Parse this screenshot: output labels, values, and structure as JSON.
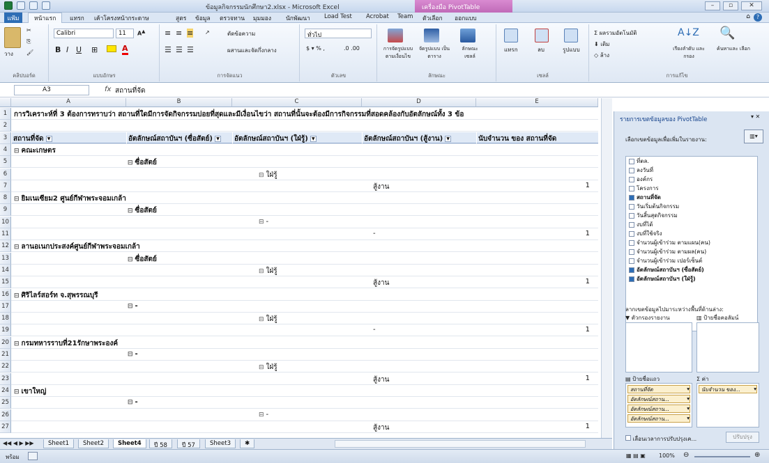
{
  "window": {
    "title": "ข้อมูลกิจกรรมนักศึกษา2.xlsx - Microsoft Excel",
    "context_tab": "เครื่องมือ PivotTable",
    "min": "–",
    "max": "▫",
    "close": "✕"
  },
  "tabs": [
    "หน้าแรก",
    "แทรก",
    "เค้าโครงหน้ากระดาษ",
    "สูตร",
    "ข้อมูล",
    "ตรวจทาน",
    "มุมมอง",
    "นักพัฒนา",
    "Load Test",
    "Acrobat",
    "Team",
    "ตัวเลือก",
    "ออกแบบ"
  ],
  "file_tab": "แฟ้ม",
  "ribbon": {
    "paste": "วาง",
    "clipboard": "คลิปบอร์ด",
    "font_name": "Calibri",
    "font_size": "11",
    "font_group": "แบบอักษร",
    "wrap": "ตัดข้อความ",
    "merge": "ผสานและจัดกึ่งกลาง",
    "align_group": "การจัดแนว",
    "number_format": "ทั่วไป",
    "number_group": "ตัวเลข",
    "cond_format": "การจัดรูปแบบ ตามเงื่อนไข",
    "format_table": "จัดรูปแบบ เป็นตาราง",
    "cell_styles": "ลักษณะ เซลล์",
    "styles_group": "ลักษณะ",
    "insert": "แทรก",
    "delete": "ลบ",
    "format": "รูปแบบ",
    "cells_group": "เซลล์",
    "autosum": "ผลรวมอัตโนมัติ",
    "fill": "เติม",
    "clear": "ล้าง",
    "sort": "เรียงลำดับ และกรอง",
    "find": "ค้นหาและ เลือก",
    "edit_group": "การแก้ไข"
  },
  "formula": {
    "name_box": "A3",
    "fx": "fx",
    "content": "สถานที่จัด"
  },
  "columns": [
    "A",
    "B",
    "C",
    "D",
    "E"
  ],
  "rows": [
    {
      "n": "1",
      "a": "การวิเคราะห์ที่ 3 ต้องการทราบว่า  สถานที่ใดมีการจัดกิจกรรมบ่อยที่สุดและมีเงื่อนไขว่า  สถานที่นั้นจะต้องมีการกิจกรรมที่สอดคล้องกับอัตลักษณ์ทั้ง  3 ข้อ"
    },
    {
      "n": "2"
    },
    {
      "n": "3",
      "header": [
        "สถานที่จัด",
        "อัตลักษณ์สถาบันฯ (ซื่อสัตย์)",
        "อัตลักษณ์สถาบันฯ (ใฝ่รู้)",
        "อัตลักษณ์สถาบันฯ (สู้งาน)",
        "นับจำนวน ของ สถานที่จัด"
      ]
    },
    {
      "n": "4",
      "a": "คณะเกษตร",
      "level": "a"
    },
    {
      "n": "5",
      "b": "ซื่อสัตย์"
    },
    {
      "n": "6",
      "c": "ใฝ่รู้"
    },
    {
      "n": "7",
      "d": "สู้งาน",
      "e": "1"
    },
    {
      "n": "8",
      "a": "ยิมเนเซียม2 ศูนย์กีฬาพระจอมเกล้า",
      "level": "a"
    },
    {
      "n": "9",
      "b": "ซื่อสัตย์"
    },
    {
      "n": "10",
      "c": "-"
    },
    {
      "n": "11",
      "d": "-",
      "e": "1"
    },
    {
      "n": "12",
      "a": "ลานอเนกประสงค์ศูนย์กีฬาพระจอมเกล้า",
      "level": "a"
    },
    {
      "n": "13",
      "b": "ซื่อสัตย์"
    },
    {
      "n": "14",
      "c": "ใฝ่รู้"
    },
    {
      "n": "15",
      "d": "สู้งาน",
      "e": "1"
    },
    {
      "n": "16",
      "a": "ศิริไลร์สอร์ท จ.สุพรรณบุรี",
      "level": "a"
    },
    {
      "n": "17",
      "b": "-"
    },
    {
      "n": "18",
      "c": "ใฝ่รู้"
    },
    {
      "n": "19",
      "d": "-",
      "e": "1"
    },
    {
      "n": "20",
      "a": "กรมทหารราบที่21รักษาพระองค์",
      "level": "a"
    },
    {
      "n": "21",
      "b": "-"
    },
    {
      "n": "22",
      "c": "ใฝ่รู้"
    },
    {
      "n": "23",
      "d": "สู้งาน",
      "e": "1"
    },
    {
      "n": "24",
      "a": "เขาใหญ่",
      "level": "a"
    },
    {
      "n": "25",
      "b": "-"
    },
    {
      "n": "26",
      "c": "-"
    },
    {
      "n": "27",
      "d": "สู้งาน",
      "e": "1"
    }
  ],
  "sheets": [
    "Sheet1",
    "Sheet2",
    "Sheet4",
    "ปี 58",
    "ปี 57",
    "Sheet3"
  ],
  "active_sheet": "Sheet4",
  "status": {
    "mode": "พร้อม",
    "zoom": "100%"
  },
  "pivot": {
    "title": "รายการเขตข้อมูลของ PivotTable",
    "choose": "เลือกเขตข้อมูลเพื่อเพิ่มในรายงาน:",
    "fields": [
      {
        "l": "ที่ตล.",
        "c": false
      },
      {
        "l": "ลงวันที่",
        "c": false
      },
      {
        "l": "องค์กร",
        "c": false
      },
      {
        "l": "โครงการ",
        "c": false
      },
      {
        "l": "สถานที่จัด",
        "c": true
      },
      {
        "l": "วันเริ่มต้นกิจกรรม",
        "c": false
      },
      {
        "l": "วันสิ้นสุดกิจกรรม",
        "c": false
      },
      {
        "l": "งบที่ได้",
        "c": false
      },
      {
        "l": "งบที่ใช้จริง",
        "c": false
      },
      {
        "l": "จำนวนผู้เข้าร่วม ตามแผน(คน)",
        "c": false
      },
      {
        "l": "จำนวนผู้เข้าร่วม ตามผล(คน)",
        "c": false
      },
      {
        "l": "จำนวนผู้เข้าร่วม เปอร์เซ็นต์",
        "c": false
      },
      {
        "l": "อัตลักษณ์สถาบันฯ (ซื่อสัตย์)",
        "c": true
      },
      {
        "l": "อัตลักษณ์สถาบันฯ (ใฝ่รู้)",
        "c": true
      }
    ],
    "drag": "ลากเขตข้อมูลไปมาระหว่างพื้นที่ด้านล่าง:",
    "filter": "ตัวกรองรายงาน",
    "col_labels": "ป้ายชื่อคอลัมน์",
    "row_labels": "ป้ายชื่อแถว",
    "values": "ค่า",
    "row_chips": [
      "สถานที่จัด",
      "อัตลักษณ์สถาน...",
      "อัตลักษณ์สถาน...",
      "อัตลักษณ์สถาน..."
    ],
    "value_chip": "นับจำนวน ของ...",
    "defer": "เลื่อนเวลาการปรับปรุงเค...",
    "update": "ปรับปรุง"
  }
}
